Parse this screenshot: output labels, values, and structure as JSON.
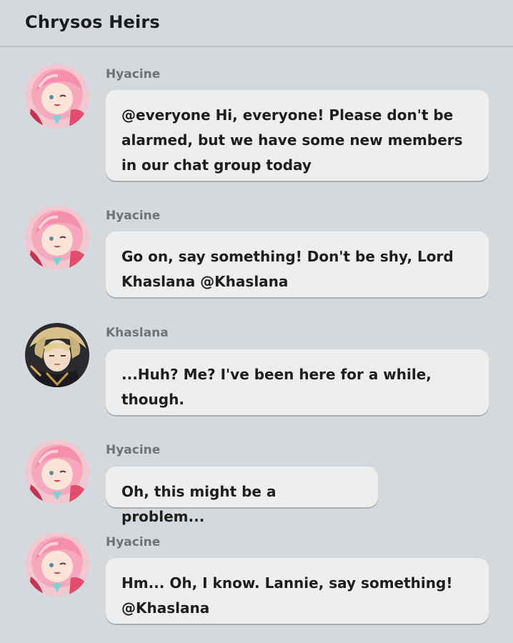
{
  "header": {
    "title": "Chrysos Heirs"
  },
  "messages": [
    {
      "sender": "Hyacine",
      "avatar": "hyacine-avatar",
      "text": "@everyone Hi, everyone! Please don't be alarmed, but we have some new members in our chat group today"
    },
    {
      "sender": "Hyacine",
      "avatar": "hyacine-avatar",
      "text": "Go on, say something! Don't be shy, Lord Khaslana @Khaslana"
    },
    {
      "sender": "Khaslana",
      "avatar": "khaslana-avatar",
      "text": "...Huh? Me? I've been here for a while, though."
    },
    {
      "sender": "Hyacine",
      "avatar": "hyacine-avatar",
      "text": "Oh, this might be a problem..."
    },
    {
      "sender": "Hyacine",
      "avatar": "hyacine-avatar",
      "text": "Hm... Oh, I know. Lannie, say something! @Khaslana"
    }
  ],
  "colors": {
    "background": "#d4d9de",
    "bubble": "#eeeeee",
    "sender_name": "#6e7378",
    "text": "#1e1e1e"
  }
}
